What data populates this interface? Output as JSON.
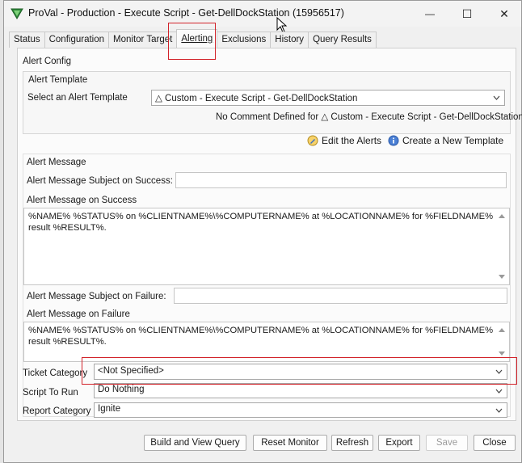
{
  "window": {
    "title": "ProVal - Production - Execute Script -  Get-DellDockStation (15956517)",
    "minimize": "—",
    "maximize": "☐",
    "close": "✕"
  },
  "tabs": [
    "Status",
    "Configuration",
    "Monitor Target",
    "Alerting",
    "Exclusions",
    "History",
    "Query Results"
  ],
  "alert_config": {
    "title": "Alert Config",
    "template_group_title": "Alert Template",
    "select_template_label": "Select an Alert Template",
    "selected_template": "△ Custom - Execute Script - Get-DellDockStation",
    "no_comment_text": "No Comment Defined for △ Custom - Execute Script - Get-DellDockStation",
    "edit_alerts_label": "Edit the Alerts",
    "create_template_label": "Create a New Template"
  },
  "alert_message": {
    "title": "Alert Message",
    "subject_success_label": "Alert Message Subject on Success:",
    "subject_success_value": "",
    "message_success_label": "Alert Message on Success",
    "message_success_value": "%NAME% %STATUS% on %CLIENTNAME%\\%COMPUTERNAME% at %LOCATIONNAME% for %FIELDNAME% result %RESULT%.",
    "subject_failure_label": "Alert Message Subject on Failure:",
    "subject_failure_value": "",
    "message_failure_label": "Alert Message on Failure",
    "message_failure_value": "%NAME% %STATUS% on %CLIENTNAME%\\%COMPUTERNAME% at %LOCATIONNAME% for %FIELDNAME% result %RESULT%."
  },
  "fields": {
    "ticket_category_label": "Ticket Category",
    "ticket_category_value": "<Not Specified>",
    "script_to_run_label": "Script To Run",
    "script_to_run_value": "Do Nothing",
    "report_category_label": "Report Category",
    "report_category_value": "Ignite"
  },
  "buttons": {
    "build_view_query": "Build and View Query",
    "reset_monitor": "Reset Monitor",
    "refresh": "Refresh",
    "export": "Export",
    "save": "Save",
    "close": "Close"
  },
  "colors": {
    "highlight": "#d2232a",
    "window_bg": "#f0f0f0"
  }
}
